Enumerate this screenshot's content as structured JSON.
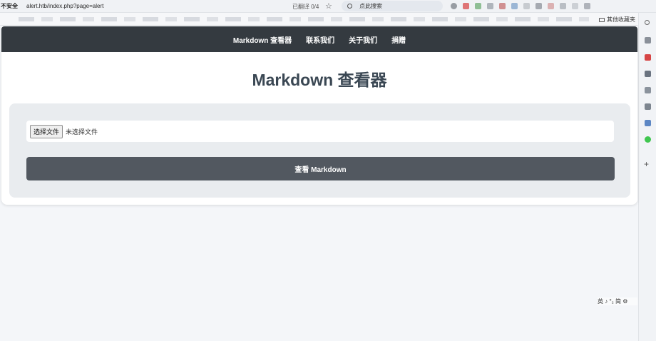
{
  "browser": {
    "security_label": "不安全",
    "url": "alert.htb/index.php?page=alert",
    "translate_label": "已翻译 0/4",
    "search_placeholder": "点此搜索",
    "other_bookmarks": "其他收藏夹",
    "ime_label": "英 ♪ °₂ 简 ⚙"
  },
  "nav": {
    "items": [
      "Markdown 查看器",
      "联系我们",
      "关于我们",
      "捐赠"
    ]
  },
  "main": {
    "title": "Markdown 查看器",
    "file_button": "选择文件",
    "file_status": "未选择文件",
    "submit_label": "查看 Markdown"
  },
  "colors": {
    "navbar": "#343a40",
    "submit": "#525860",
    "card": "#e9ecef",
    "title": "#3a4753"
  }
}
